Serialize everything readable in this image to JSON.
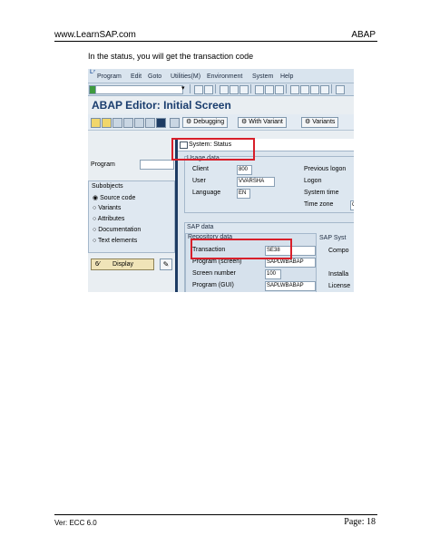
{
  "page": {
    "header_left": "www.LearnSAP.com",
    "header_right": "ABAP",
    "intro": "In the status, you will get the transaction code",
    "footer_left": "Ver: ECC 6.0",
    "footer_right": "Page: 18"
  },
  "sap": {
    "menu": [
      "Program",
      "Edit",
      "Goto",
      "Utilities(M)",
      "Environment",
      "System",
      "Help"
    ],
    "title": "ABAP Editor: Initial Screen",
    "app_buttons": {
      "debugging": "Debugging",
      "with_variant": "With Variant",
      "variants": "Variants"
    },
    "program_label": "Program",
    "subobjects": {
      "title": "Subobjects",
      "items": [
        "Source code",
        "Variants",
        "Attributes",
        "Documentation",
        "Text elements"
      ]
    },
    "display_label": "Display",
    "dialog": {
      "title": "System: Status",
      "usage_title": "Usage data",
      "client_label": "Client",
      "client_value": "800",
      "user_label": "User",
      "user_value": "VVARSHA",
      "language_label": "Language",
      "language_value": "EN",
      "previous_logon": "Previous logon",
      "logon": "Logon",
      "system_time": "System time",
      "time_zone": "Time zone",
      "time_zone_value": "C",
      "sap_data_title": "SAP data",
      "repo_title": "Repository data",
      "transaction_label": "Transaction",
      "transaction_value": "SE38",
      "program_screen_label": "Program (screen)",
      "program_screen_value": "SAPLWBABAP",
      "screen_number_label": "Screen number",
      "screen_number_value": "100",
      "program_gui_label": "Program (GUI)",
      "program_gui_value": "SAPLWBABAP",
      "sap_system_title": "SAP Syst",
      "component": "Compo",
      "installation": "Installa",
      "license": "License"
    }
  }
}
